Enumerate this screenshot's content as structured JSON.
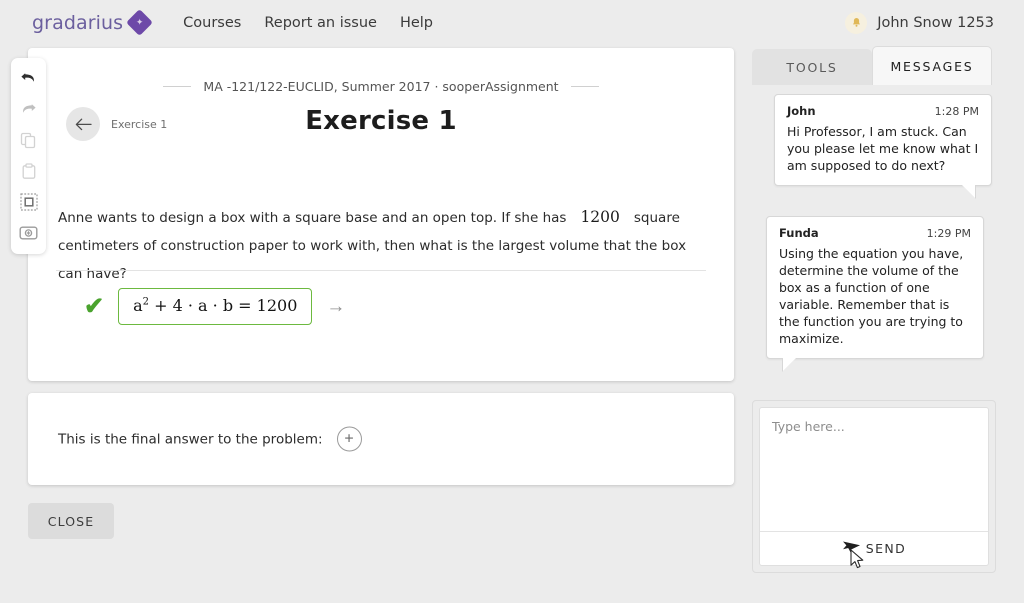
{
  "topnav": {
    "logo_text": "gradarius",
    "logo_icon": "diamond-logo-icon",
    "links": [
      {
        "label": "Courses"
      },
      {
        "label": "Report an issue"
      },
      {
        "label": "Help"
      }
    ],
    "bell_icon": "bell-icon",
    "user_name": "John Snow 1253"
  },
  "left_toolbar": {
    "items": [
      {
        "icon": "undo-icon",
        "active": true
      },
      {
        "icon": "redo-icon",
        "active": false
      },
      {
        "icon": "copy-icon",
        "active": false
      },
      {
        "icon": "clipboard-paste-icon",
        "active": false
      },
      {
        "icon": "select-region-icon",
        "active": false
      },
      {
        "icon": "insert-box-icon",
        "active": false
      }
    ]
  },
  "exercise": {
    "course_line": "MA -121/122-EUCLID, Summer 2017 · sooperAssignment",
    "back_icon": "arrow-left-icon",
    "back_label": "Exercise 1",
    "heading": "Exercise 1",
    "problem_part1": "Anne wants to design a box with a square base and an open top. If she has",
    "problem_value": "1200",
    "problem_part2": "square centimeters of construction paper to work with, then what is the largest volume that the box can have?",
    "step": {
      "status_icon": "green-checkmark-icon",
      "equation_base": "a",
      "equation_exp": "2",
      "equation_rest": " + 4 · a · b = 1200",
      "next_icon": "arrow-right-icon",
      "border_color": "#6cb93f",
      "check_color": "#4aa32e"
    }
  },
  "final_answer": {
    "label": "This is the final answer to the problem:",
    "add_icon": "plus-circle-icon"
  },
  "close_button": {
    "label": "CLOSE"
  },
  "right_panel": {
    "tabs": [
      {
        "label": "TOOLS",
        "active": false
      },
      {
        "label": "MESSAGES",
        "active": true
      }
    ],
    "messages": [
      {
        "name": "John",
        "time": "1:28 PM",
        "text": "Hi Professor, I am stuck. Can you please let me know what I am supposed to do next?"
      },
      {
        "name": "Funda",
        "time": "1:29 PM",
        "text": "Using the equation you have, determine the volume of the box as a function of one variable. Remember that is the function you are trying to maximize."
      }
    ],
    "compose": {
      "placeholder": "Type here...",
      "value": "",
      "send_icon": "send-paper-plane-icon",
      "send_label": "SEND"
    }
  },
  "cursor": {
    "icon": "mouse-pointer-icon"
  },
  "colors": {
    "brand_purple": "#6d49a8",
    "accent_green": "#6cb93f",
    "page_bg": "#ececec"
  }
}
